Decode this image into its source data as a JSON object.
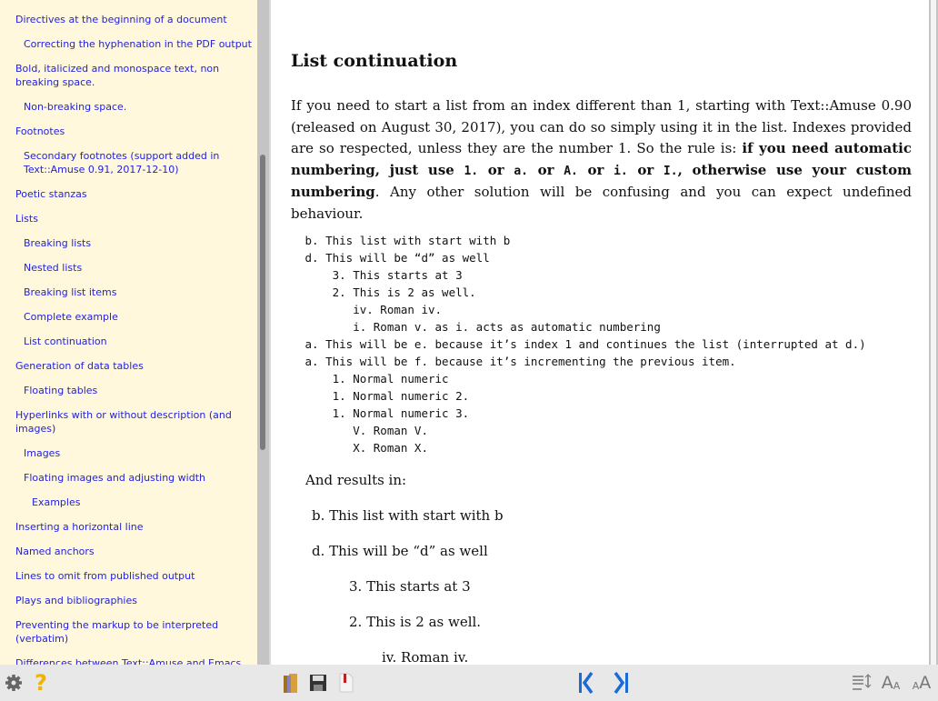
{
  "toc": [
    {
      "label": "Directives at the beginning of a document",
      "level": 1
    },
    {
      "label": "Correcting the hyphenation in the PDF output",
      "level": 2
    },
    {
      "label": "Bold, italicized and monospace text, non breaking space.",
      "level": 1
    },
    {
      "label": "Non-breaking space.",
      "level": 2
    },
    {
      "label": "Footnotes",
      "level": 1
    },
    {
      "label": "Secondary footnotes (support added in Text::Amuse 0.91, 2017-12-10)",
      "level": 2
    },
    {
      "label": "Poetic stanzas",
      "level": 1
    },
    {
      "label": "Lists",
      "level": 1
    },
    {
      "label": "Breaking lists",
      "level": 2
    },
    {
      "label": "Nested lists",
      "level": 2
    },
    {
      "label": "Breaking list items",
      "level": 2
    },
    {
      "label": "Complete example",
      "level": 2
    },
    {
      "label": "List continuation",
      "level": 2
    },
    {
      "label": "Generation of data tables",
      "level": 1
    },
    {
      "label": "Floating tables",
      "level": 2
    },
    {
      "label": "Hyperlinks with or without description (and images)",
      "level": 1
    },
    {
      "label": "Images",
      "level": 2
    },
    {
      "label": "Floating images and adjusting width",
      "level": 2
    },
    {
      "label": "Examples",
      "level": 3
    },
    {
      "label": "Inserting a horizontal line",
      "level": 1
    },
    {
      "label": "Named anchors",
      "level": 1
    },
    {
      "label": "Lines to omit from published output",
      "level": 1
    },
    {
      "label": "Plays and bibliographies",
      "level": 1
    },
    {
      "label": "Preventing the markup to be interpreted (verbatim)",
      "level": 1
    },
    {
      "label": "Differences between Text::Amuse and Emacs",
      "level": 1
    }
  ],
  "main": {
    "title": "List continuation",
    "p1": "If you need to start a list from an index different than 1, starting with Text::Amuse 0.90 (released on August 30, 2017), you can do so simply using it in the list. Indexes provided are so respected, unless they are the number 1. So the rule is: ",
    "bold1": "if you need automatic numbering, just use ",
    "c1": "1.",
    "or1": " or ",
    "c2": "a.",
    "or2": " or ",
    "c3": "A.",
    "or3": " or ",
    "c4": "i.",
    "or4": " or ",
    "c5": "I.",
    "bold2": ", otherwise use your custom numbering",
    "p2": ". Any other solution will be confusing and you can expect undefined behaviour.",
    "code": " b. This list with start with b\n d. This will be “d” as well\n     3. This starts at 3\n     2. This is 2 as well.\n        iv. Roman iv.\n        i. Roman v. as i. acts as automatic numbering\n a. This will be e. because it’s index 1 and continues the list (interrupted at d.)\n a. This will be f. because it’s incrementing the previous item.\n     1. Normal numeric\n     1. Normal numeric 2.\n     1. Normal numeric 3.\n        V. Roman V.\n        X. Roman X.",
    "results_intro": "And results in:",
    "results": [
      "b. This list with start with b",
      "d. This will be “d” as well",
      "3. This starts at 3",
      "2. This is 2 as well.",
      "iv. Roman iv."
    ]
  },
  "toolbar": {
    "left": [
      "gear-icon",
      "help-icon"
    ],
    "middle": [
      "library-icon",
      "save-icon",
      "pdf-icon"
    ],
    "nav": [
      "first-page-icon",
      "last-page-icon"
    ],
    "right": [
      "line-spacing-icon",
      "decrease-font-icon",
      "increase-font-icon"
    ]
  }
}
